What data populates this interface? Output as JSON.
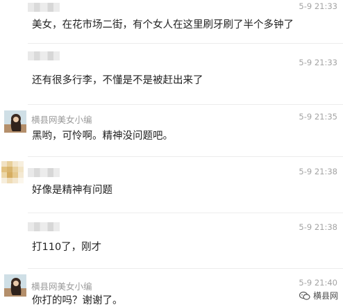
{
  "colors": {
    "background": "#ffffff",
    "text": "#222222",
    "meta": "#a3a3a3",
    "divider": "#ececec"
  },
  "messages": [
    {
      "sender": "",
      "avatar": "none",
      "time": "5-9 21:33",
      "text": "美女，在花市场二街，有个女人在这里刷牙刷了半个多钟了"
    },
    {
      "sender": "",
      "avatar": "none",
      "time": "5-9 21:33",
      "text": "还有很多行李，不懂是不是被赶出来了"
    },
    {
      "sender": "横县网美女小编",
      "avatar": "photo-avatar",
      "time": "5-9 21:35",
      "text": "黑哟，可怜啊。精神没问题吧。"
    },
    {
      "sender": "",
      "avatar": "pixelated-avatar",
      "time": "5-9 21:38",
      "text": "好像是精神有问题"
    },
    {
      "sender": "",
      "avatar": "none",
      "time": "5-9 21:38",
      "text": "打110了，刚才"
    },
    {
      "sender": "横县网美女小编",
      "avatar": "photo-avatar",
      "time": "5-9 21:40",
      "text": "你打的吗？谢谢了。"
    }
  ],
  "watermark": {
    "icon": "wechat-channel-icon",
    "label": "横县网"
  }
}
